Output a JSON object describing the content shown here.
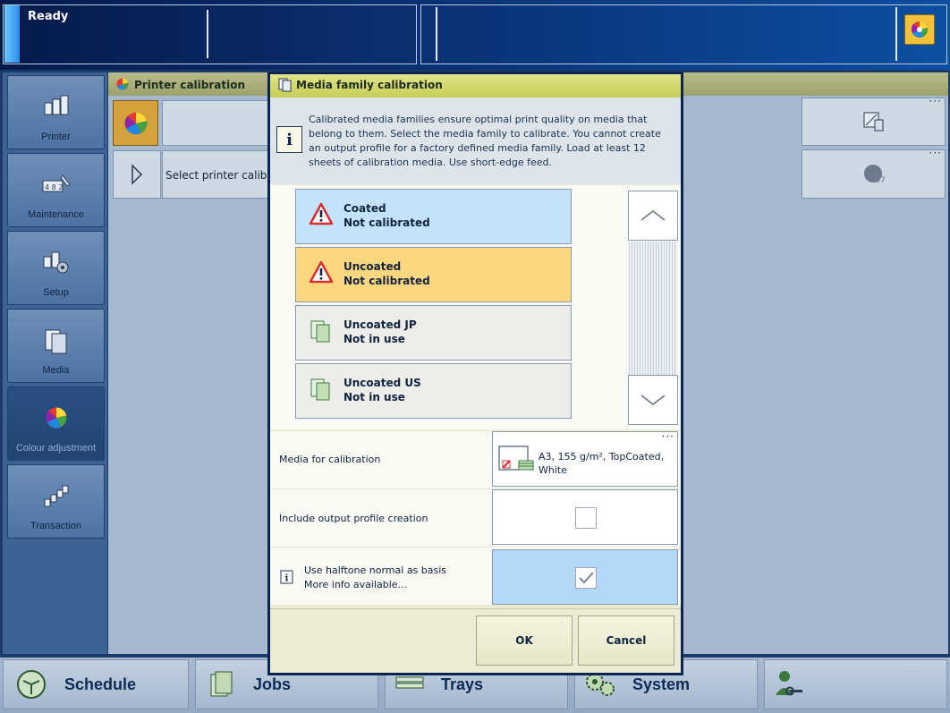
{
  "status": {
    "text": "Ready"
  },
  "nav": {
    "items": [
      {
        "label": "Printer",
        "icon": "printer-icon"
      },
      {
        "label": "Maintenance",
        "icon": "maintenance-icon"
      },
      {
        "label": "Setup",
        "icon": "setup-icon"
      },
      {
        "label": "Media",
        "icon": "media-icon"
      },
      {
        "label": "Colour adjustment",
        "icon": "colour-wheel-icon",
        "active": true
      },
      {
        "label": "Transaction",
        "icon": "transaction-icon"
      }
    ]
  },
  "background": {
    "title": "Printer calibration",
    "select_label": "Select printer calibratio"
  },
  "dialog": {
    "title": "Media family calibration",
    "info": "Calibrated media families ensure optimal print quality on media that belong to them. Select the media family to calibrate. You cannot create an output profile for a factory defined media family. Load at least 12 sheets of calibration media. Use short-edge feed.",
    "families": [
      {
        "name": "Coated",
        "state": "Not calibrated",
        "icon": "warning-icon",
        "color": "#c4e3fb"
      },
      {
        "name": "Uncoated",
        "state": "Not calibrated",
        "icon": "warning-icon",
        "color": "#fdd680"
      },
      {
        "name": "Uncoated JP",
        "state": "Not in use",
        "icon": "media-family-icon",
        "color": "#ededea"
      },
      {
        "name": "Uncoated US",
        "state": "Not in use",
        "icon": "media-family-icon",
        "color": "#ededea"
      }
    ],
    "media_for_calibration": {
      "label": "Media for calibration",
      "value": "A3, 155 g/m², TopCoated, White",
      "more": "···"
    },
    "include_profile": {
      "label": "Include output profile creation",
      "checked": false
    },
    "halftone": {
      "label": "Use halftone normal as basis",
      "sub": "More info available...",
      "checked": true
    },
    "ok_label": "OK",
    "cancel_label": "Cancel"
  },
  "bottom": {
    "items": [
      {
        "label": "Schedule",
        "icon": "clock-icon"
      },
      {
        "label": "Jobs",
        "icon": "jobs-icon"
      },
      {
        "label": "Trays",
        "icon": "trays-icon"
      },
      {
        "label": "System",
        "icon": "gears-icon"
      },
      {
        "label": "",
        "icon": "user-key-icon"
      }
    ]
  },
  "colors": {
    "accent": "#0b2550",
    "selected_row": "#c4e3fb",
    "warning_row": "#fdd680",
    "checkbox_on_bg": "#b4d8f7"
  }
}
